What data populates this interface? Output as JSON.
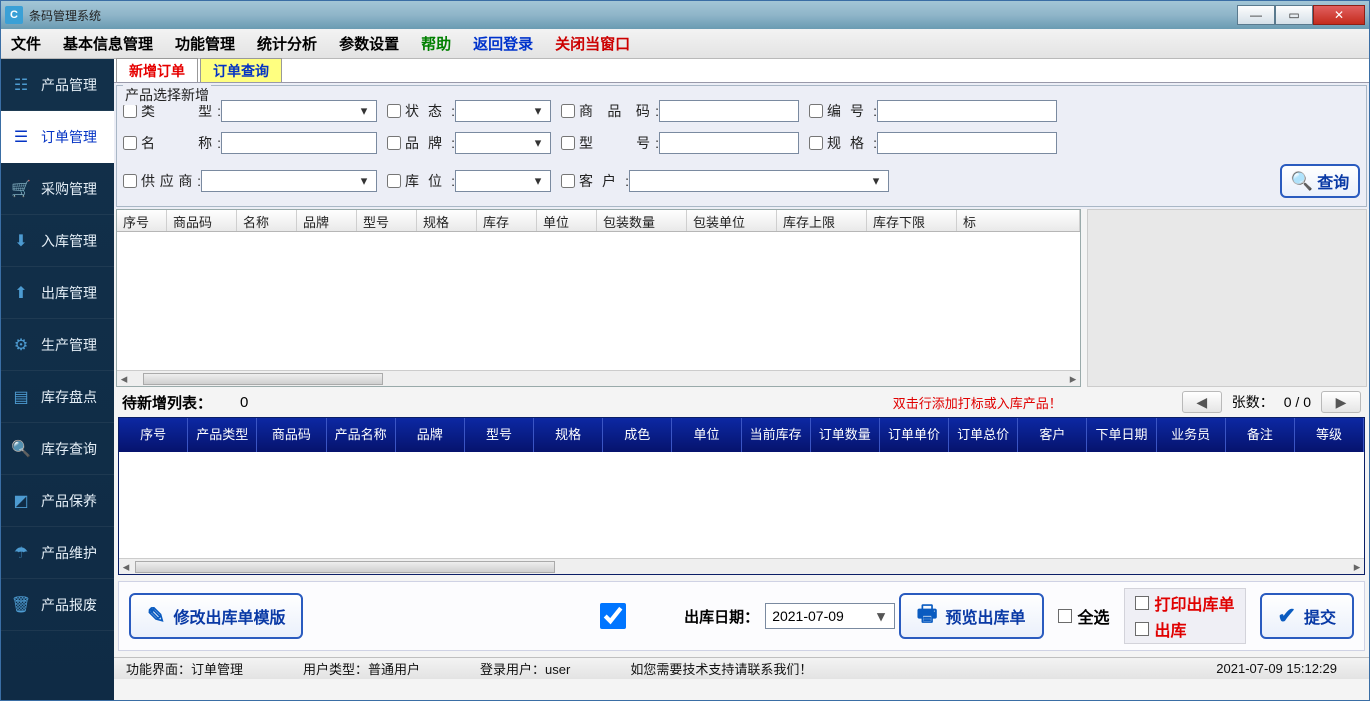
{
  "window": {
    "title": "条码管理系统"
  },
  "menubar": {
    "file": "文件",
    "basic": "基本信息管理",
    "func": "功能管理",
    "stats": "统计分析",
    "params": "参数设置",
    "help": "帮助",
    "back": "返回登录",
    "closewin": "关闭当窗口"
  },
  "sidebar": {
    "items": [
      {
        "label": "产品管理",
        "icon": "☷"
      },
      {
        "label": "订单管理",
        "icon": "☰"
      },
      {
        "label": "采购管理",
        "icon": "🛒"
      },
      {
        "label": "入库管理",
        "icon": "⬇"
      },
      {
        "label": "出库管理",
        "icon": "⬆"
      },
      {
        "label": "生产管理",
        "icon": "⚙"
      },
      {
        "label": "库存盘点",
        "icon": "▤"
      },
      {
        "label": "库存查询",
        "icon": "🔍"
      },
      {
        "label": "产品保养",
        "icon": "◩"
      },
      {
        "label": "产品维护",
        "icon": "☂"
      },
      {
        "label": "产品报废",
        "icon": "🗑"
      }
    ]
  },
  "tabs": {
    "new": "新增订单",
    "query": "订单查询"
  },
  "search": {
    "legend": "产品选择新增",
    "type_label": "类　　型:",
    "status_label": "状态:",
    "code_label": "商 品 码:",
    "no_label": "编号:",
    "name_label": "名　　称:",
    "brand_label": "品牌:",
    "model_label": "型　　号:",
    "spec_label": "规格:",
    "supplier_label": "供应商:",
    "loc_label": "库位:",
    "customer_label": "客户:",
    "query_btn": "查询"
  },
  "grid1_headers": [
    "序号",
    "商品码",
    "名称",
    "品牌",
    "型号",
    "规格",
    "库存",
    "单位",
    "包装数量",
    "包装单位",
    "库存上限",
    "库存下限",
    "标"
  ],
  "pending": {
    "label": "待新增列表：",
    "count": "0",
    "hint": "双击行添加打标或入库产品！",
    "pager_label": "张数：",
    "pager_value": "0  /  0"
  },
  "grid2_headers": [
    "序号",
    "产品类型",
    "商品码",
    "产品名称",
    "品牌",
    "型号",
    "规格",
    "成色",
    "单位",
    "当前库存",
    "订单数量",
    "订单单价",
    "订单总价",
    "客户",
    "下单日期",
    "业务员",
    "备注",
    "等级"
  ],
  "bottom": {
    "modify": "修改出库单模版",
    "date_label": "出库日期：",
    "date_value": "2021-07-09",
    "preview": "预览出库单",
    "select_all": "全选",
    "print": "打印出库单",
    "outbound": "出库",
    "submit": "提交"
  },
  "status": {
    "panel": "功能界面：订单管理",
    "usertype": "用户类型：普通用户",
    "user": "登录用户：user",
    "support": "如您需要技术支持请联系我们！",
    "time": "2021-07-09 15:12:29"
  }
}
